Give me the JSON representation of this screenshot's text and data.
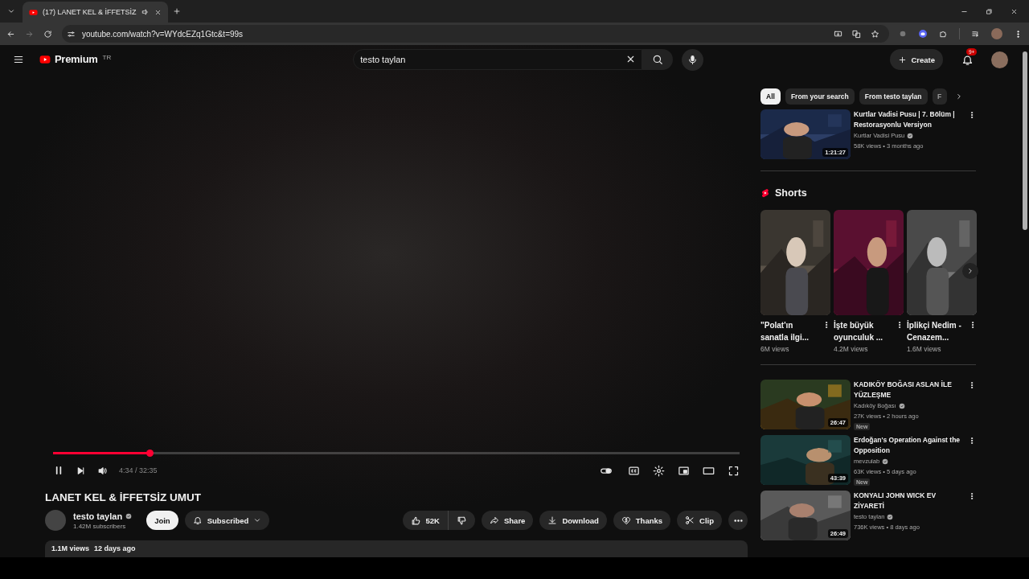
{
  "browser": {
    "tab": {
      "title": "(17) LANET KEL & İFFETSİZ",
      "audio": true
    },
    "url": "youtube.com/watch?v=WYdcEZq1Gtc&t=99s"
  },
  "header": {
    "logo": "Premium",
    "region": "TR",
    "search": {
      "value": "testo taylan"
    },
    "create": "Create",
    "notifications": "9+"
  },
  "player": {
    "playing": true,
    "progress": {
      "level": 0.14
    },
    "time": "4:34 / 32:35"
  },
  "video": {
    "title": "LANET KEL & İFFETSİZ UMUT",
    "channel": "testo taylan",
    "verified": true,
    "subscribers": "1.42M subscribers",
    "join": "Join",
    "subscribed": "Subscribed",
    "likes": "52K",
    "actions": [
      {
        "kind": "share",
        "label": "Share"
      },
      {
        "kind": "download",
        "label": "Download"
      },
      {
        "kind": "thanks",
        "label": "Thanks"
      },
      {
        "kind": "clip",
        "label": "Clip"
      }
    ],
    "views": "1.1M views",
    "date": "12 days ago"
  },
  "sidebar": {
    "chips": [
      {
        "label": "All",
        "selected": true
      },
      {
        "label": "From your search",
        "selected": false
      },
      {
        "label": "From testo taylan",
        "selected": false
      },
      {
        "label": "F",
        "selected": false
      }
    ],
    "top_videos": [
      {
        "title": "Kurtlar Vadisi Pusu | 7. Bölüm | Restorasyonlu Versiyon",
        "channel": "Kurtlar Vadisi Pusu",
        "verified": true,
        "meta": "58K views • 3 months ago",
        "duration": "1:21:27"
      }
    ],
    "shorts": {
      "title": "Shorts",
      "items": [
        {
          "title": "\"Polat'ın sanatla ilgi...",
          "views": "6M views"
        },
        {
          "title": "İşte büyük oyunculuk ...",
          "views": "4.2M views"
        },
        {
          "title": "İplikçi Nedim - Cenazem...",
          "views": "1.6M views"
        }
      ]
    },
    "videos": [
      {
        "title": "KADIKÖY BOĞASI ASLAN İLE YÜZLEŞME",
        "channel": "Kadıköy Boğası",
        "verified": true,
        "meta": "27K views • 2 hours ago",
        "duration": "26:47",
        "badge": "New"
      },
      {
        "title": "Erdoğan's Operation Against the Opposition",
        "channel": "mevzulab",
        "verified": true,
        "meta": "63K views • 5 days ago",
        "duration": "43:39",
        "badge": "New"
      },
      {
        "title": "KONYALI JOHN WICK EV ZİYARETİ",
        "channel": "testo taylan",
        "verified": true,
        "meta": "736K views • 8 days ago",
        "duration": "26:49"
      }
    ]
  }
}
